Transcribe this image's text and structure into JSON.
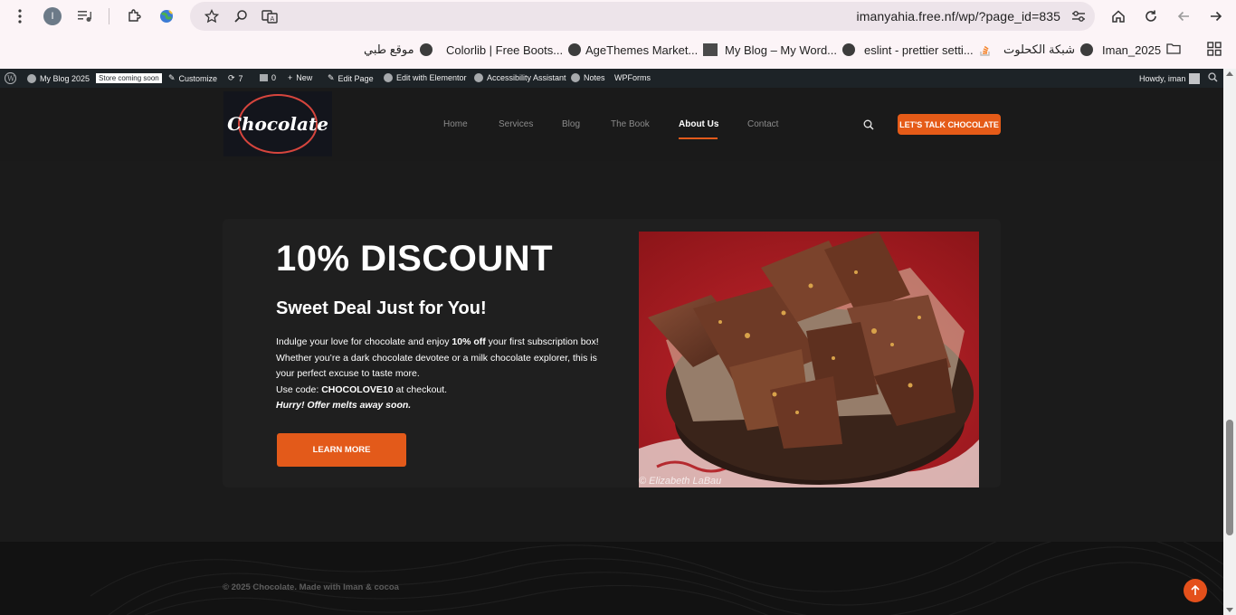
{
  "browser": {
    "profile_initial": "I",
    "url": "imanyahia.free.nf/wp/?page_id=835",
    "bookmarks": [
      {
        "label": "موقع طبي",
        "icon": "globe-icon"
      },
      {
        "label": "Colorlib | Free Boots...",
        "icon": "globe-icon"
      },
      {
        "label": "AgeThemes Market...",
        "icon": "agethemes-icon"
      },
      {
        "label": "My Blog – My Word...",
        "icon": "globe-icon"
      },
      {
        "label": "eslint - prettier setti...",
        "icon": "stackoverflow-icon"
      },
      {
        "label": "شبكة الكحلوت",
        "icon": "globe-icon"
      },
      {
        "label": "Iman_2025",
        "icon": "folder-icon"
      }
    ]
  },
  "admin_bar": {
    "site_name": "My Blog 2025",
    "badge": "Store coming soon",
    "customize": "Customize",
    "updates": "7",
    "comments": "0",
    "new": "New",
    "edit_page": "Edit Page",
    "elementor": "Edit with Elementor",
    "accessibility": "Accessibility Assistant",
    "notes": "Notes",
    "wpforms": "WPForms",
    "howdy": "Howdy, iman"
  },
  "header": {
    "logo_text": "Chocolate",
    "nav": [
      "Home",
      "Services",
      "Blog",
      "The Book",
      "About Us",
      "Contact"
    ],
    "active_nav": "About Us",
    "cta": "LET'S TALK CHOCOLATE"
  },
  "promo": {
    "title": "10% DISCOUNT",
    "subtitle": "Sweet Deal Just for You!",
    "line1_pre": "Indulge your love for chocolate  and enjoy ",
    "line1_bold": "10% off",
    "line1_post": " your first subscription box!",
    "line2": "Whether you’re a dark chocolate devotee or a milk chocolate explorer, this is",
    "line3": "your perfect excuse to taste more.",
    "code_pre": "Use code: ",
    "code": "CHOCOLOVE10",
    "code_post": " at checkout.",
    "hurry": "Hurry! Offer melts away soon.",
    "button": "LEARN MORE",
    "image_watermark": "© Elizabeth LaBau"
  },
  "footer": {
    "copyright": "© 2025 Chocolate. Made with Iman & cocoa"
  },
  "colors": {
    "accent": "#e55b18",
    "background": "#1b1b1b",
    "admin_bar": "#1d2327"
  }
}
